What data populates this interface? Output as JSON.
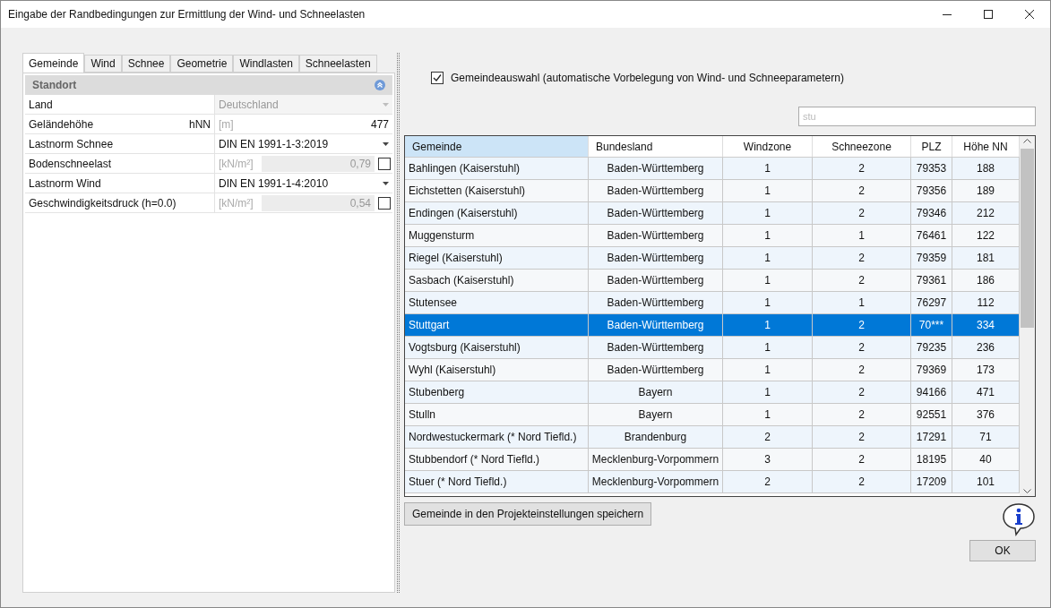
{
  "window": {
    "title": "Eingabe der Randbedingungen zur Ermittlung der Wind- und Schneelasten"
  },
  "tabs": [
    {
      "label": "Gemeinde",
      "selected": true
    },
    {
      "label": "Wind",
      "selected": false
    },
    {
      "label": "Schnee",
      "selected": false
    },
    {
      "label": "Geometrie",
      "selected": false
    },
    {
      "label": "Windlasten",
      "selected": false
    },
    {
      "label": "Schneelasten",
      "selected": false
    }
  ],
  "property_grid": {
    "category": "Standort",
    "expanded": true,
    "rows": [
      {
        "kind": "select",
        "label": "Land",
        "value": "Deutschland",
        "disabled": true
      },
      {
        "kind": "number",
        "label": "Geländehöhe",
        "symbol": "hNN",
        "unit": "[m]",
        "value": "477"
      },
      {
        "kind": "select",
        "label": "Lastnorm Schnee",
        "value": "DIN EN 1991-1-3:2019",
        "disabled": false
      },
      {
        "kind": "unit_check",
        "label": "Bodenschneelast",
        "unit": "[kN/m²]",
        "value": "0,79",
        "checked": false
      },
      {
        "kind": "select",
        "label": "Lastnorm Wind",
        "value": "DIN EN 1991-1-4:2010",
        "disabled": false
      },
      {
        "kind": "unit_check",
        "label": "Geschwindigkeitsdruck (h=0.0)",
        "unit": "[kN/m²]",
        "value": "0,54",
        "checked": false
      }
    ]
  },
  "municipality_option": {
    "label": "Gemeindeauswahl (automatische Vorbelegung von Wind- und Schneeparametern)",
    "checked": true
  },
  "search": {
    "value": "stu"
  },
  "table": {
    "columns": [
      {
        "label": "Gemeinde",
        "selected": true
      },
      {
        "label": "Bundesland",
        "selected": false
      },
      {
        "label": "Windzone",
        "selected": false
      },
      {
        "label": "Schneezone",
        "selected": false
      },
      {
        "label": "PLZ",
        "selected": false
      },
      {
        "label": "Höhe NN",
        "selected": false
      }
    ],
    "rows": [
      {
        "cells": [
          "Bahlingen (Kaiserstuhl)",
          "Baden-Württemberg",
          "1",
          "2",
          "79353",
          "188"
        ],
        "selected": false
      },
      {
        "cells": [
          "Eichstetten (Kaiserstuhl)",
          "Baden-Württemberg",
          "1",
          "2",
          "79356",
          "189"
        ],
        "selected": false
      },
      {
        "cells": [
          "Endingen (Kaiserstuhl)",
          "Baden-Württemberg",
          "1",
          "2",
          "79346",
          "212"
        ],
        "selected": false
      },
      {
        "cells": [
          "Muggensturm",
          "Baden-Württemberg",
          "1",
          "1",
          "76461",
          "122"
        ],
        "selected": false
      },
      {
        "cells": [
          "Riegel (Kaiserstuhl)",
          "Baden-Württemberg",
          "1",
          "2",
          "79359",
          "181"
        ],
        "selected": false
      },
      {
        "cells": [
          "Sasbach (Kaiserstuhl)",
          "Baden-Württemberg",
          "1",
          "2",
          "79361",
          "186"
        ],
        "selected": false
      },
      {
        "cells": [
          "Stutensee",
          "Baden-Württemberg",
          "1",
          "1",
          "76297",
          "112"
        ],
        "selected": false
      },
      {
        "cells": [
          "Stuttgart",
          "Baden-Württemberg",
          "1",
          "2",
          "70***",
          "334"
        ],
        "selected": true
      },
      {
        "cells": [
          "Vogtsburg (Kaiserstuhl)",
          "Baden-Württemberg",
          "1",
          "2",
          "79235",
          "236"
        ],
        "selected": false
      },
      {
        "cells": [
          "Wyhl (Kaiserstuhl)",
          "Baden-Württemberg",
          "1",
          "2",
          "79369",
          "173"
        ],
        "selected": false
      },
      {
        "cells": [
          "Stubenberg",
          "Bayern",
          "1",
          "2",
          "94166",
          "471"
        ],
        "selected": false
      },
      {
        "cells": [
          "Stulln",
          "Bayern",
          "1",
          "2",
          "92551",
          "376"
        ],
        "selected": false
      },
      {
        "cells": [
          "Nordwestuckermark (* Nord Tiefld.)",
          "Brandenburg",
          "2",
          "2",
          "17291",
          "71"
        ],
        "selected": false
      },
      {
        "cells": [
          "Stubbendorf (* Nord Tiefld.)",
          "Mecklenburg-Vorpommern",
          "3",
          "2",
          "18195",
          "40"
        ],
        "selected": false
      },
      {
        "cells": [
          "Stuer (* Nord Tiefld.)",
          "Mecklenburg-Vorpommern",
          "2",
          "2",
          "17209",
          "101"
        ],
        "selected": false
      }
    ]
  },
  "buttons": {
    "save": "Gemeinde in den Projekteinstellungen speichern",
    "ok": "OK"
  }
}
